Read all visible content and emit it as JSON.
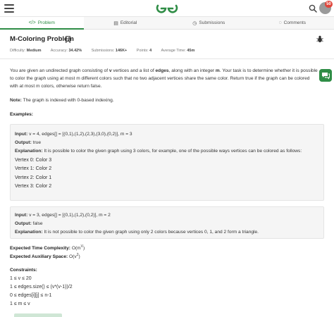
{
  "header": {
    "logo_alt": "GfG",
    "notification_count": "50",
    "colors": {
      "brand": "#2f8d46",
      "badge": "#e0453a"
    }
  },
  "tabs": [
    {
      "label": "Problem",
      "icon": "code-icon",
      "active": true
    },
    {
      "label": "Editorial",
      "icon": "document-icon",
      "active": false
    },
    {
      "label": "Submissions",
      "icon": "clock-icon",
      "active": false
    },
    {
      "label": "Comments",
      "icon": "comment-icon",
      "active": false
    }
  ],
  "problem": {
    "title": "M-Coloring Problem",
    "meta": {
      "difficulty_label": "Difficulty:",
      "difficulty": "Medium",
      "accuracy_label": "Accuracy:",
      "accuracy": "34.42%",
      "submissions_label": "Submissions:",
      "submissions": "146K+",
      "points_label": "Points:",
      "points": "4",
      "avg_time_label": "Average Time:",
      "avg_time": "45m"
    },
    "description": {
      "p1": "You are given an undirected graph consisting of ",
      "v": "v",
      "p2": " vertices and a list of ",
      "edges": "edges",
      "p3": ", along with an integer ",
      "m": "m",
      "p4": ". Your task is to determine whether it is possible to color the graph using at most m different colors such that no two adjacent vertices share the same color. Return true if the graph can be colored with at most m colors, otherwise return false."
    },
    "note_label": "Note:",
    "note_text": " The graph is indexed with 0-based indexing.",
    "examples_heading": "Examples:",
    "example1": {
      "input_label": "Input:",
      "input": " v = 4, edges[] = [(0,1),(1,2),(2,3),(3,0),(0,2)], m = 3",
      "output_label": "Output:",
      "output": " true",
      "explanation_label": "Explanation:",
      "explanation": " It is possible to color the given graph using 3 colors, for example, one of the possible ways vertices can be colored as follows:",
      "lines": [
        "Vertex 0: Color 3",
        "Vertex 1: Color 2",
        "Vertex 2: Color 1",
        "Vertex 3: Color 2"
      ]
    },
    "example2": {
      "input_label": "Input:",
      "input": " v = 3, edges[] = [(0,1),(1,2),(0,2)], m = 2",
      "output_label": "Output:",
      "output": " false",
      "explanation_label": "Explanation:",
      "explanation": " It is not possible to color the given graph using only 2 colors because vertices 0, 1, and 2 form a triangle."
    },
    "time_complexity_label": "Expected Time Complexity:",
    "time_complexity_base": " O(m",
    "time_complexity_sup": "V",
    "time_complexity_end": ")",
    "space_complexity_label": "Expected Auxiliary Space:",
    "space_complexity_base": " O(v",
    "space_complexity_sup": "2",
    "space_complexity_end": ")",
    "constraints_heading": "Constraints:",
    "constraints": [
      "1 ≤ v ≤ 20",
      "1 ≤ edges.size() ≤ (v*(v-1))/2",
      "0 ≤ edges[i][j] ≤ n-1",
      "1 ≤ m ≤ v"
    ]
  }
}
